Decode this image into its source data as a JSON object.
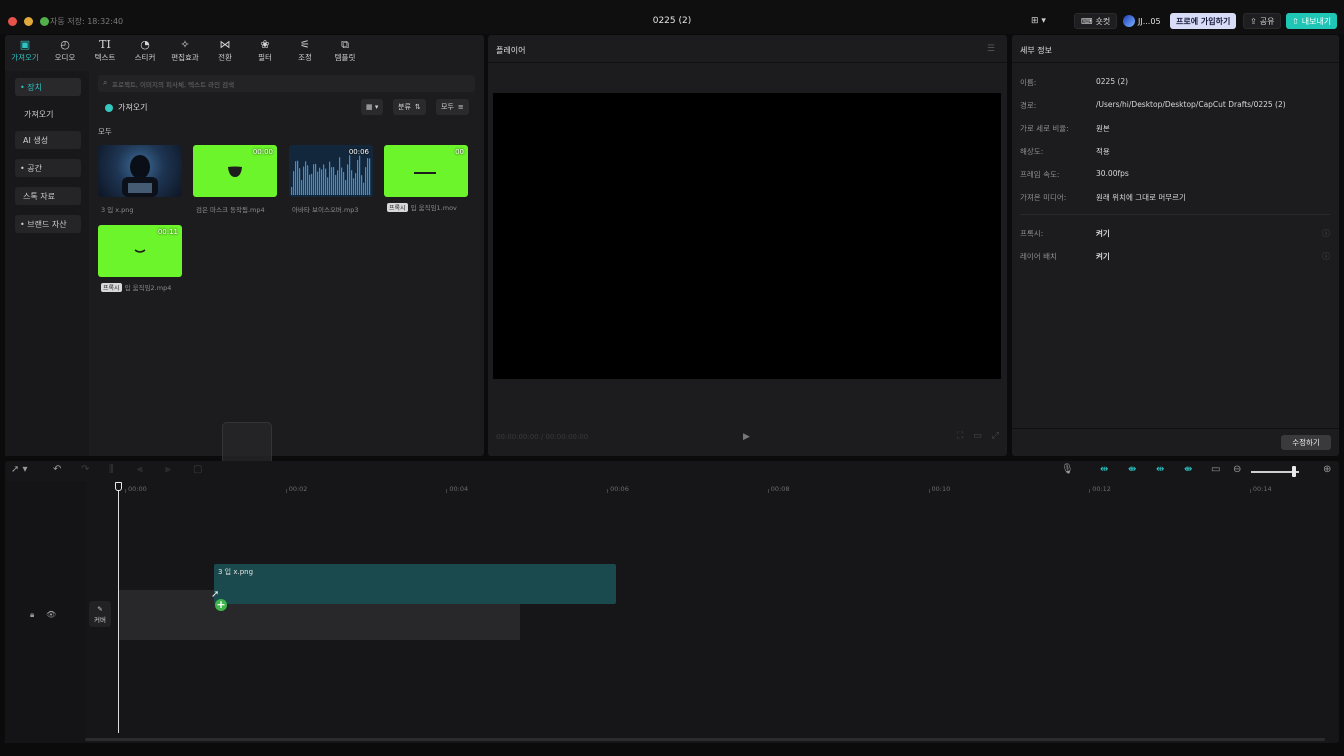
{
  "titlebar": {
    "autosave": "자동 저장: 18:32:40",
    "title": "0225 (2)",
    "shortcut_label": "숏컷",
    "user_label": "JJ...05",
    "pro_label": "프로에 가입하기",
    "share_label": "공유",
    "export_label": "내보내기"
  },
  "tabs": [
    {
      "label": "가져오기",
      "icon": "import-icon"
    },
    {
      "label": "오디오",
      "icon": "audio-icon"
    },
    {
      "label": "텍스트",
      "icon": "text-icon"
    },
    {
      "label": "스티커",
      "icon": "sticker-icon"
    },
    {
      "label": "편집효과",
      "icon": "effects-icon"
    },
    {
      "label": "전환",
      "icon": "transition-icon"
    },
    {
      "label": "필터",
      "icon": "filter-icon"
    },
    {
      "label": "조정",
      "icon": "adjust-icon"
    },
    {
      "label": "템플릿",
      "icon": "template-icon"
    }
  ],
  "sidebar": {
    "items": [
      "• 장치",
      "가져오기",
      "AI 생성",
      "• 공간",
      "스톡 자료",
      "• 브랜드 자산"
    ]
  },
  "media": {
    "search_placeholder": "프로젝트, 이미지의 피사체, 텍스트 라인 검색",
    "import_label": "가져오기",
    "sort_label": "분류",
    "filter_label": "모두",
    "all_label": "모두",
    "items": [
      {
        "name": "3 입 x.png",
        "duration": "",
        "badge": ""
      },
      {
        "name": "검은 마스크 동작됨.mp4",
        "duration": "00:00",
        "badge": ""
      },
      {
        "name": "아바타 보이스오버.mp3",
        "duration": "00:06",
        "badge": ""
      },
      {
        "name": "입 움직임1.mov",
        "duration": "00",
        "badge": "프록시"
      },
      {
        "name": "입 움직임2.mp4",
        "duration": "00:11",
        "badge": "프록시"
      }
    ]
  },
  "player": {
    "title": "플레이어",
    "timecode": "00:00:00:00 / 00:00:00:00"
  },
  "details": {
    "title": "세부 정보",
    "rows": [
      {
        "key": "이름:",
        "value": "0225 (2)"
      },
      {
        "key": "경로:",
        "value": "/Users/hi/Desktop/Desktop/CapCut Drafts/0225 (2)"
      },
      {
        "key": "가로 세로 비율:",
        "value": "원본"
      },
      {
        "key": "해상도:",
        "value": "적용"
      },
      {
        "key": "프레임 속도:",
        "value": "30.00fps"
      },
      {
        "key": "가져온 미디어:",
        "value": "원래 위치에 그대로 머무르기"
      }
    ],
    "extra_rows": [
      {
        "key": "프록시:",
        "value": "켜기"
      },
      {
        "key": "레이어 배치",
        "value": "켜기"
      }
    ],
    "modify_label": "수정하기"
  },
  "timeline": {
    "ruler": [
      "00:00",
      "00:02",
      "00:04",
      "00:06",
      "00:08",
      "00:10",
      "00:12",
      "00:14"
    ],
    "clip_label": "3 입 x.png",
    "cover_label": "커버",
    "zoom_fraction": 0.9
  },
  "colors": {
    "accent": "#2ec4c4",
    "export_button": "#1fc6b6",
    "chroma_green": "#6cf52a",
    "clip": "#1a4a4d"
  }
}
